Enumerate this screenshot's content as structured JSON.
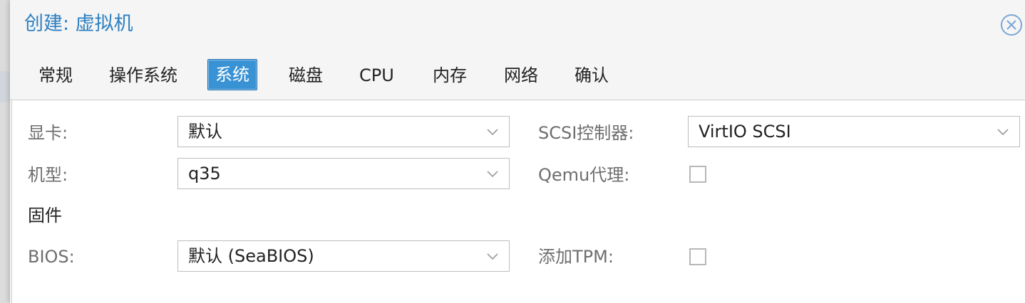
{
  "dialog": {
    "title": "创建: 虚拟机",
    "close_icon": "close-circle-icon",
    "accent_color": "#2d7fc1"
  },
  "tabs": [
    {
      "label": "常规",
      "active": false
    },
    {
      "label": "操作系统",
      "active": false
    },
    {
      "label": "系统",
      "active": true
    },
    {
      "label": "磁盘",
      "active": false
    },
    {
      "label": "CPU",
      "active": false
    },
    {
      "label": "内存",
      "active": false
    },
    {
      "label": "网络",
      "active": false
    },
    {
      "label": "确认",
      "active": false
    }
  ],
  "form": {
    "graphics_card": {
      "label": "显卡:",
      "value": "默认"
    },
    "machine": {
      "label": "机型:",
      "value": "q35"
    },
    "firmware_section": "固件",
    "bios": {
      "label": "BIOS:",
      "value": "默认 (SeaBIOS)"
    },
    "scsi_controller": {
      "label": "SCSI控制器:",
      "value": "VirtIO SCSI"
    },
    "qemu_agent": {
      "label": "Qemu代理:",
      "checked": false
    },
    "add_tpm": {
      "label": "添加TPM:",
      "checked": false
    }
  },
  "icons": {
    "dropdown": "chevron-down-icon",
    "checkbox": "checkbox-icon"
  }
}
